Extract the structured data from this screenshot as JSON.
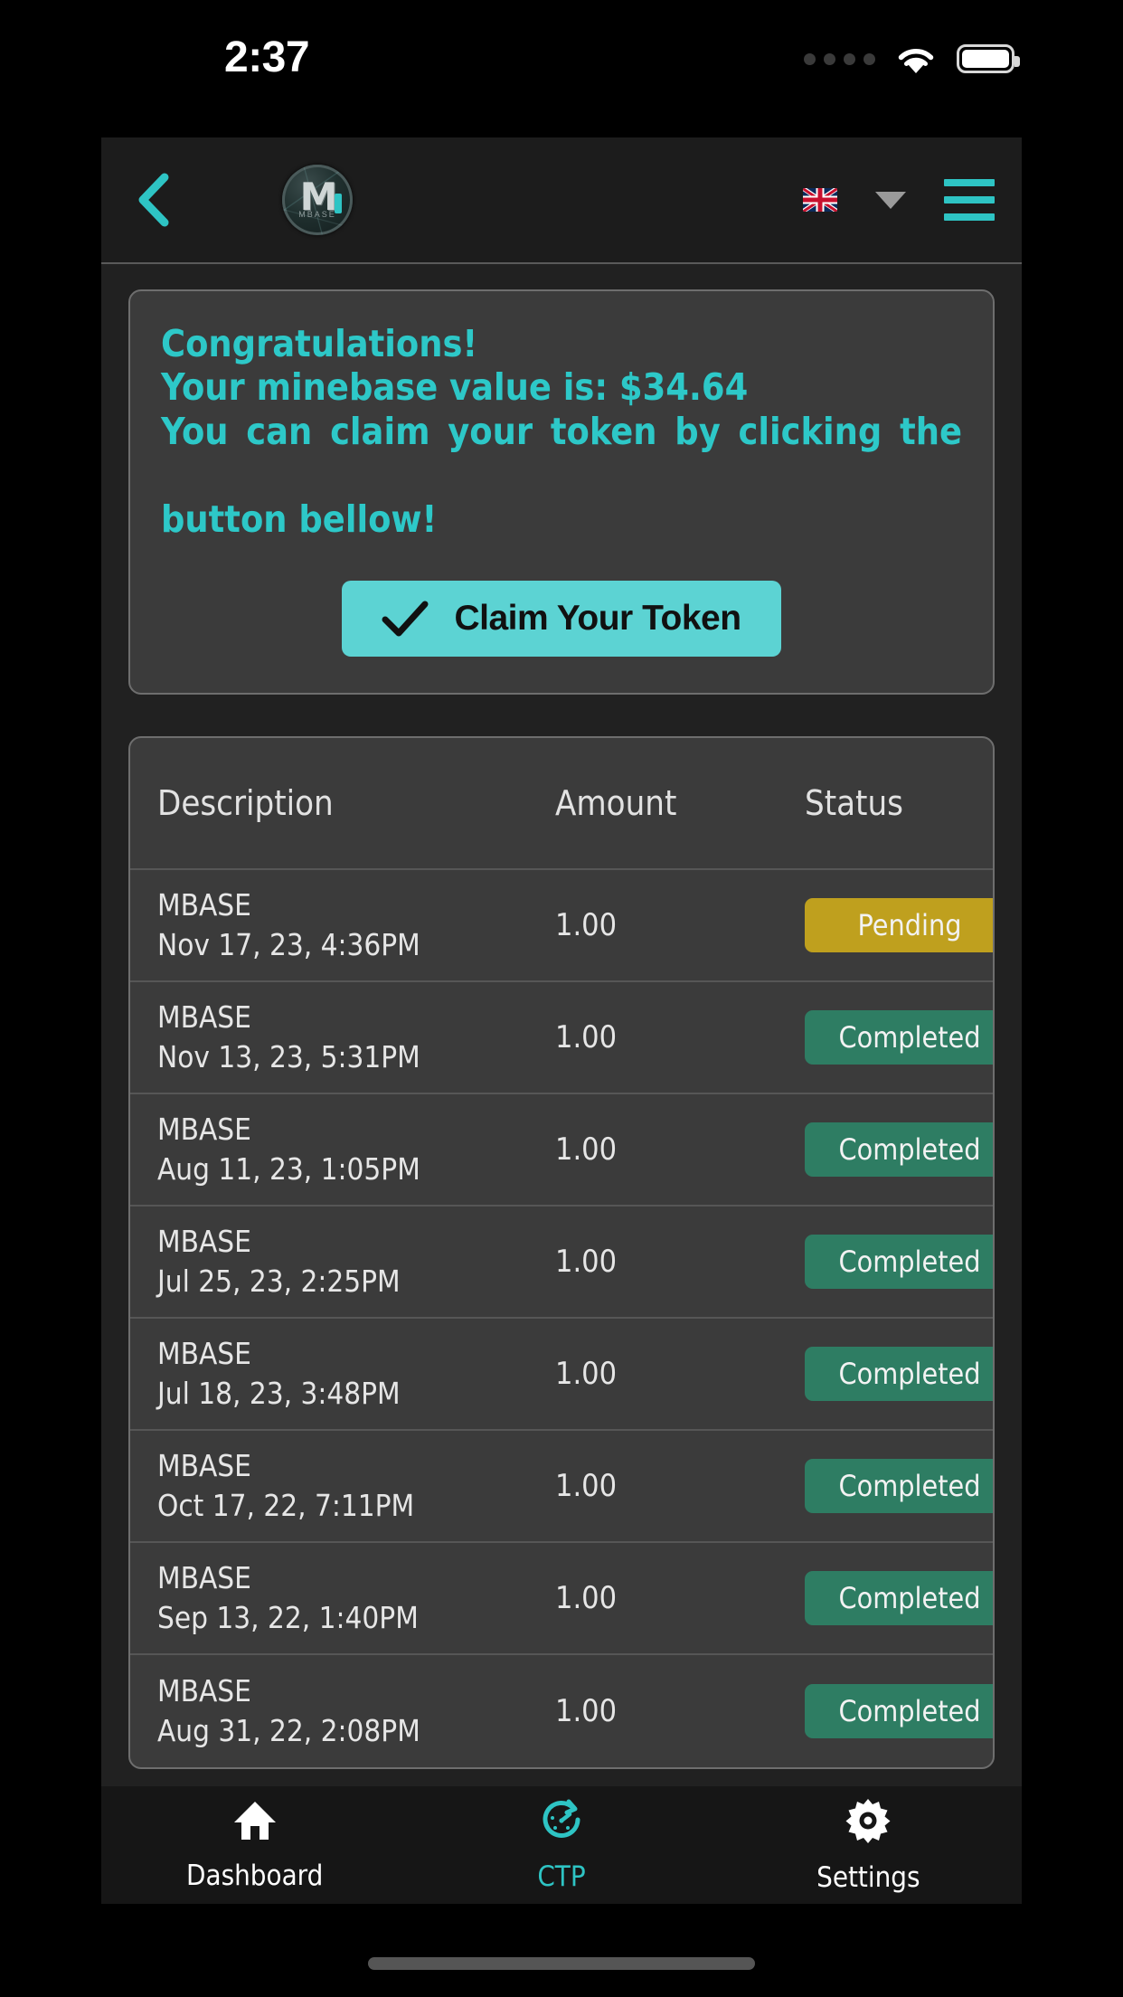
{
  "status_bar": {
    "time": "2:37",
    "signal_icon": "signal-dots-icon",
    "wifi_icon": "wifi-icon",
    "battery_icon": "battery-full-icon"
  },
  "app_bar": {
    "back_icon": "back-chevron-icon",
    "logo": {
      "icon": "mbase-coin-logo",
      "letter": "M",
      "sublabel": "MBASE"
    },
    "language_flag": "uk-flag-icon",
    "language_caret": "caret-down-icon",
    "menu_icon": "hamburger-menu-icon"
  },
  "promo_card": {
    "line1": "Congratulations!",
    "line2": "Your minebase value is: $34.64",
    "line3": "You can claim your token by clicking the",
    "line4": "button bellow!",
    "claim_button": {
      "label": "Claim Your Token",
      "icon": "check-icon"
    }
  },
  "transactions": {
    "columns": [
      "Description",
      "Amount",
      "Status"
    ],
    "rows": [
      {
        "token": "MBASE",
        "date": "Nov 17, 23, 4:36PM",
        "amount": "1.00",
        "status": "Pending",
        "status_type": "pending"
      },
      {
        "token": "MBASE",
        "date": "Nov 13, 23, 5:31PM",
        "amount": "1.00",
        "status": "Completed",
        "status_type": "completed"
      },
      {
        "token": "MBASE",
        "date": "Aug 11, 23, 1:05PM",
        "amount": "1.00",
        "status": "Completed",
        "status_type": "completed"
      },
      {
        "token": "MBASE",
        "date": "Jul 25, 23, 2:25PM",
        "amount": "1.00",
        "status": "Completed",
        "status_type": "completed"
      },
      {
        "token": "MBASE",
        "date": "Jul 18, 23, 3:48PM",
        "amount": "1.00",
        "status": "Completed",
        "status_type": "completed"
      },
      {
        "token": "MBASE",
        "date": "Oct 17, 22, 7:11PM",
        "amount": "1.00",
        "status": "Completed",
        "status_type": "completed"
      },
      {
        "token": "MBASE",
        "date": "Sep 13, 22, 1:40PM",
        "amount": "1.00",
        "status": "Completed",
        "status_type": "completed"
      },
      {
        "token": "MBASE",
        "date": "Aug 31, 22, 2:08PM",
        "amount": "1.00",
        "status": "Completed",
        "status_type": "completed"
      }
    ]
  },
  "bottom_nav": {
    "items": [
      {
        "label": "Dashboard",
        "icon": "home-icon",
        "active": false
      },
      {
        "label": "CTP",
        "icon": "gauge-icon",
        "active": true
      },
      {
        "label": "Settings",
        "icon": "gear-icon",
        "active": false
      }
    ]
  },
  "colors": {
    "accent_teal": "#2ec4c4",
    "button_teal": "#5cd3d3",
    "pending_gold": "#bfa01e",
    "completed_green": "#2e7d63",
    "card_bg": "#3b3b3b",
    "app_bg": "#212121"
  }
}
